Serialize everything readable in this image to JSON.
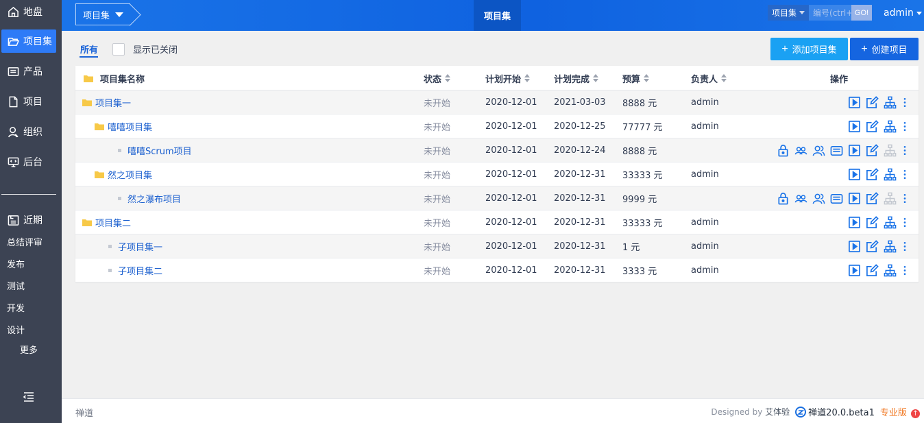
{
  "sidebar": {
    "items": [
      {
        "label": "地盘",
        "icon": "home-icon"
      },
      {
        "label": "项目集",
        "icon": "folder-open-icon"
      },
      {
        "label": "产品",
        "icon": "product-icon"
      },
      {
        "label": "项目",
        "icon": "file-icon"
      },
      {
        "label": "组织",
        "icon": "user-icon"
      },
      {
        "label": "后台",
        "icon": "monitor-icon"
      }
    ],
    "recent_label": "近期",
    "sub_items": [
      "总结评审",
      "发布",
      "测试",
      "开发",
      "设计"
    ],
    "more_label": "更多"
  },
  "header": {
    "breadcrumb": "项目集",
    "center_tab": "项目集",
    "search_type": "项目集",
    "search_placeholder": "编号(ctrl+",
    "go_label": "GO!",
    "user": "admin"
  },
  "toolbar": {
    "tab_all": "所有",
    "show_closed": "显示已关闭",
    "add_set": "添加项目集",
    "create_project": "创建项目"
  },
  "table": {
    "columns": [
      "项目集名称",
      "状态",
      "计划开始",
      "计划完成",
      "预算",
      "负责人",
      "操作"
    ],
    "rows": [
      {
        "kind": "set",
        "level": 0,
        "name": "项目集一",
        "status": "未开始",
        "start": "2020-12-01",
        "end": "2021-03-03",
        "budget": "8888 元",
        "owner": "admin",
        "actions": "set"
      },
      {
        "kind": "set",
        "level": 1,
        "name": "嘻嘻项目集",
        "status": "未开始",
        "start": "2020-12-01",
        "end": "2020-12-25",
        "budget": "77777 元",
        "owner": "admin",
        "actions": "set"
      },
      {
        "kind": "project",
        "level": 2,
        "name": "嘻嘻Scrum项目",
        "status": "未开始",
        "start": "2020-12-01",
        "end": "2020-12-24",
        "budget": "8888 元",
        "owner": "",
        "actions": "project"
      },
      {
        "kind": "set",
        "level": 1,
        "name": "然之项目集",
        "status": "未开始",
        "start": "2020-12-01",
        "end": "2020-12-31",
        "budget": "33333 元",
        "owner": "admin",
        "actions": "set"
      },
      {
        "kind": "project",
        "level": 2,
        "name": "然之瀑布项目",
        "status": "未开始",
        "start": "2020-12-01",
        "end": "2020-12-31",
        "budget": "9999 元",
        "owner": "",
        "actions": "project"
      },
      {
        "kind": "set",
        "level": 0,
        "name": "项目集二",
        "status": "未开始",
        "start": "2020-12-01",
        "end": "2020-12-31",
        "budget": "33333 元",
        "owner": "admin",
        "actions": "set"
      },
      {
        "kind": "child",
        "level": 1,
        "name": "子项目集一",
        "status": "未开始",
        "start": "2020-12-01",
        "end": "2020-12-31",
        "budget": "1 元",
        "owner": "admin",
        "actions": "set"
      },
      {
        "kind": "child",
        "level": 1,
        "name": "子项目集二",
        "status": "未开始",
        "start": "2020-12-01",
        "end": "2020-12-31",
        "budget": "3333 元",
        "owner": "admin",
        "actions": "set"
      }
    ]
  },
  "footer": {
    "left": "禅道",
    "designed_by": "Designed by",
    "designer": "艾体验",
    "version": "禅道20.0.beta1",
    "edition": "专业版"
  },
  "colors": {
    "sidebar_bg": "#3c4353",
    "active_blue": "#2e7bf7",
    "link_blue": "#1a5fcf",
    "action_blue": "#1a73e8",
    "folder_yellow": "#f7c948",
    "edition_orange": "#f0731a"
  }
}
